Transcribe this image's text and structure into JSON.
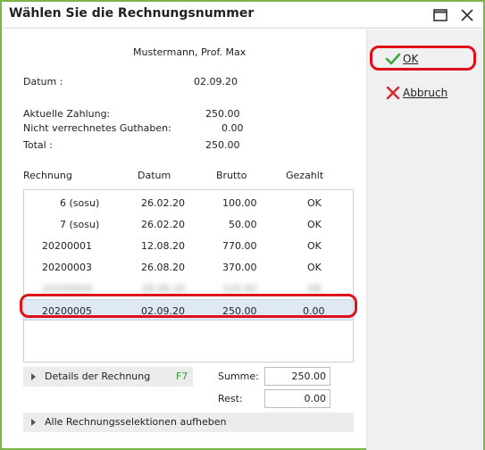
{
  "window": {
    "title": "Wählen Sie die Rechnungsnummer"
  },
  "patient": {
    "name": "Mustermann, Prof. Max"
  },
  "info": {
    "datum_label": "Datum :",
    "datum_value": "02.09.20",
    "aktuelle_label": "Aktuelle Zahlung:",
    "aktuelle_value": "250.00",
    "guthaben_label": "Nicht verrechnetes Guthaben:",
    "guthaben_value": "0.00",
    "total_label": "Total :",
    "total_value": "250.00"
  },
  "table": {
    "headers": [
      "Rechnung",
      "Datum",
      "Brutto",
      "Gezahlt"
    ],
    "rows": [
      {
        "rechnung": "6 (sosu)",
        "datum": "26.02.20",
        "brutto": "100.00",
        "gezahlt": "OK"
      },
      {
        "rechnung": "7 (sosu)",
        "datum": "26.02.20",
        "brutto": "50.00",
        "gezahlt": "OK"
      },
      {
        "rechnung": "20200001",
        "datum": "12.08.20",
        "brutto": "770.00",
        "gezahlt": "OK"
      },
      {
        "rechnung": "20200003",
        "datum": "26.08.20",
        "brutto": "370.00",
        "gezahlt": "OK"
      },
      {
        "rechnung": "20200004",
        "datum": "28.08.20",
        "brutto": "120.00",
        "gezahlt": "OK"
      },
      {
        "rechnung": "20200005",
        "datum": "02.09.20",
        "brutto": "250.00",
        "gezahlt": "0.00"
      }
    ]
  },
  "details": {
    "label": "Details der Rechnung",
    "shortcut": "F7"
  },
  "summary": {
    "summe_label": "Summe:",
    "summe_value": "250.00",
    "rest_label": "Rest:",
    "rest_value": "0.00"
  },
  "clear_selection": {
    "label": "Alle Rechnungsselektionen aufheben"
  },
  "buttons": {
    "ok": "OK",
    "cancel": "Abbruch"
  },
  "colors": {
    "accent_border": "#7ab648",
    "highlight": "#e0101a",
    "ok_check": "#3aa83a",
    "cancel_x": "#d9262c",
    "shortcut": "#2e9a3e"
  }
}
